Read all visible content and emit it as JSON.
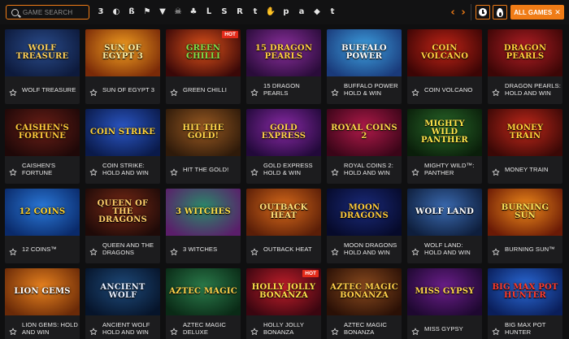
{
  "search": {
    "placeholder": "GAME SEARCH"
  },
  "providers": [
    {
      "name": "provider-3oaks-icon",
      "glyph": "3"
    },
    {
      "name": "provider-circle-icon",
      "glyph": "◐"
    },
    {
      "name": "provider-booming-icon",
      "glyph": "ß"
    },
    {
      "name": "provider-flag-icon",
      "glyph": "⚑"
    },
    {
      "name": "provider-triangle-icon",
      "glyph": "▼"
    },
    {
      "name": "provider-skull-icon",
      "glyph": "☠"
    },
    {
      "name": "provider-tree-icon",
      "glyph": "♣"
    },
    {
      "name": "provider-bracket-icon",
      "glyph": "ᒪ"
    },
    {
      "name": "provider-s-icon",
      "glyph": "S"
    },
    {
      "name": "provider-r-icon",
      "glyph": "R"
    },
    {
      "name": "provider-t-icon",
      "glyph": "t"
    },
    {
      "name": "provider-hand-icon",
      "glyph": "✋"
    },
    {
      "name": "provider-p-icon",
      "glyph": "p"
    },
    {
      "name": "provider-a-icon",
      "glyph": "a"
    },
    {
      "name": "provider-diamond-icon",
      "glyph": "◆"
    },
    {
      "name": "provider-t2-icon",
      "glyph": "t"
    }
  ],
  "nav": {
    "prev": "‹",
    "next": "›"
  },
  "filter": {
    "label": "ALL GAMES",
    "close": "✕"
  },
  "colors": {
    "accent": "#f07c16",
    "hot": "#e42b1a",
    "card": "#1c1c1e"
  },
  "games": [
    {
      "title": "WOLF TREASURE",
      "logo": "WOLF TREASURE",
      "bg": [
        "#2a4c8c",
        "#0d1a3c"
      ],
      "fg": "#ffd25a",
      "hot": ""
    },
    {
      "title": "SUN OF EGYPT 3",
      "logo": "SUN OF EGYPT 3",
      "bg": [
        "#f4a020",
        "#7a2a08"
      ],
      "fg": "#fff3a8",
      "hot": ""
    },
    {
      "title": "GREEN CHILLI",
      "logo": "GREEN CHILLI",
      "bg": [
        "#e0521a",
        "#3a0808"
      ],
      "fg": "#7ee04a",
      "hot": "HOT"
    },
    {
      "title": "15 DRAGON PEARLS",
      "logo": "15 DRAGON PEARLS",
      "bg": [
        "#8c2f9e",
        "#2a0c3a"
      ],
      "fg": "#ffcf40",
      "hot": ""
    },
    {
      "title": "BUFFALO POWER HOLD & WIN",
      "logo": "BUFFALO POWER",
      "bg": [
        "#3da0e0",
        "#1a3a7a"
      ],
      "fg": "#ffffff",
      "hot": ""
    },
    {
      "title": "COIN VOLCANO",
      "logo": "COIN VOLCANO",
      "bg": [
        "#c22416",
        "#3c0505"
      ],
      "fg": "#ffd040",
      "hot": ""
    },
    {
      "title": "DRAGON PEARLS: HOLD AND WIN",
      "logo": "DRAGON PEARLS",
      "bg": [
        "#b21e24",
        "#3c0606"
      ],
      "fg": "#ffcf3a",
      "hot": ""
    },
    {
      "title": "CAISHEN'S FORTUNE",
      "logo": "CAISHEN'S FORTUNE",
      "bg": [
        "#6a1e16",
        "#1e0808"
      ],
      "fg": "#ffcb3c",
      "hot": ""
    },
    {
      "title": "COIN STRIKE: HOLD AND WIN",
      "logo": "COIN STRIKE",
      "bg": [
        "#2a56c4",
        "#0a1a4a"
      ],
      "fg": "#ffd33a",
      "hot": ""
    },
    {
      "title": "HIT THE GOLD!",
      "logo": "HIT THE GOLD!",
      "bg": [
        "#9a5a22",
        "#2e1a0a"
      ],
      "fg": "#ffd64a",
      "hot": ""
    },
    {
      "title": "GOLD EXPRESS HOLD & WIN",
      "logo": "GOLD EXPRESS",
      "bg": [
        "#8a2aa6",
        "#22093a"
      ],
      "fg": "#ffd04a",
      "hot": ""
    },
    {
      "title": "ROYAL COINS 2: HOLD AND WIN",
      "logo": "ROYAL COINS 2",
      "bg": [
        "#b01a4a",
        "#3a0518"
      ],
      "fg": "#ffd84a",
      "hot": ""
    },
    {
      "title": "MIGHTY WILD™: PANTHER",
      "logo": "MIGHTY WILD PANTHER",
      "bg": [
        "#2a6a2a",
        "#0a1e0a"
      ],
      "fg": "#ffe44a",
      "hot": ""
    },
    {
      "title": "MONEY TRAIN",
      "logo": "MONEY TRAIN",
      "bg": [
        "#c2281a",
        "#3a0806"
      ],
      "fg": "#ffd23a",
      "hot": ""
    },
    {
      "title": "12 COINS™",
      "logo": "12 COINS",
      "bg": [
        "#2a78d8",
        "#0a2a6a"
      ],
      "fg": "#ffd22a",
      "hot": ""
    },
    {
      "title": "QUEEN AND THE DRAGONS",
      "logo": "QUEEN OF THE DRAGONS",
      "bg": [
        "#7a2a16",
        "#1e0a08"
      ],
      "fg": "#ffcf6a",
      "hot": ""
    },
    {
      "title": "3 WITCHES",
      "logo": "3 WITCHES",
      "bg": [
        "#2a8a6a",
        "#5a1e6a"
      ],
      "fg": "#ffe04a",
      "hot": ""
    },
    {
      "title": "OUTBACK HEAT",
      "logo": "OUTBACK HEAT",
      "bg": [
        "#d86a1a",
        "#5a1e08"
      ],
      "fg": "#ffe07a",
      "hot": ""
    },
    {
      "title": "MOON DRAGONS HOLD AND WIN",
      "logo": "MOON DRAGONS",
      "bg": [
        "#1a2a7a",
        "#060a2a"
      ],
      "fg": "#ffcb3a",
      "hot": ""
    },
    {
      "title": "WOLF LAND: HOLD AND WIN",
      "logo": "WOLF LAND",
      "bg": [
        "#3a6ab0",
        "#0e1e3c"
      ],
      "fg": "#ffffff",
      "hot": ""
    },
    {
      "title": "BURNING SUN™",
      "logo": "BURNING SUN",
      "bg": [
        "#f08a1a",
        "#6a1a06"
      ],
      "fg": "#ffe45a",
      "hot": ""
    },
    {
      "title": "LION GEMS: HOLD AND WIN",
      "logo": "LION GEMS",
      "bg": [
        "#e8821e",
        "#6a2a08"
      ],
      "fg": "#ffffff",
      "hot": ""
    },
    {
      "title": "ANCIENT WOLF HOLD AND WIN",
      "logo": "ANCIENT WOLF",
      "bg": [
        "#1e4a7a",
        "#06142a"
      ],
      "fg": "#e8f0ff",
      "hot": ""
    },
    {
      "title": "AZTEC MAGIC DELUXE",
      "logo": "AZTEC MAGIC",
      "bg": [
        "#2a7a4a",
        "#0a2a16"
      ],
      "fg": "#ffd24a",
      "hot": ""
    },
    {
      "title": "HOLLY JOLLY BONANZA",
      "logo": "HOLLY JOLLY BONANZA",
      "bg": [
        "#c21e2a",
        "#3a0610"
      ],
      "fg": "#ffe24a",
      "hot": "HOT"
    },
    {
      "title": "AZTEC MAGIC BONANZA",
      "logo": "AZTEC MAGIC BONANZA",
      "bg": [
        "#8a4a1e",
        "#2a1006"
      ],
      "fg": "#ffd04a",
      "hot": ""
    },
    {
      "title": "MISS GYPSY",
      "logo": "MISS GYPSY",
      "bg": [
        "#6a1e8a",
        "#1e0830"
      ],
      "fg": "#ffd84a",
      "hot": ""
    },
    {
      "title": "BIG MAX POT HUNTER",
      "logo": "BIG MAX POT HUNTER",
      "bg": [
        "#2a6ad8",
        "#0a1e5a"
      ],
      "fg": "#ff3a2a",
      "hot": ""
    }
  ]
}
